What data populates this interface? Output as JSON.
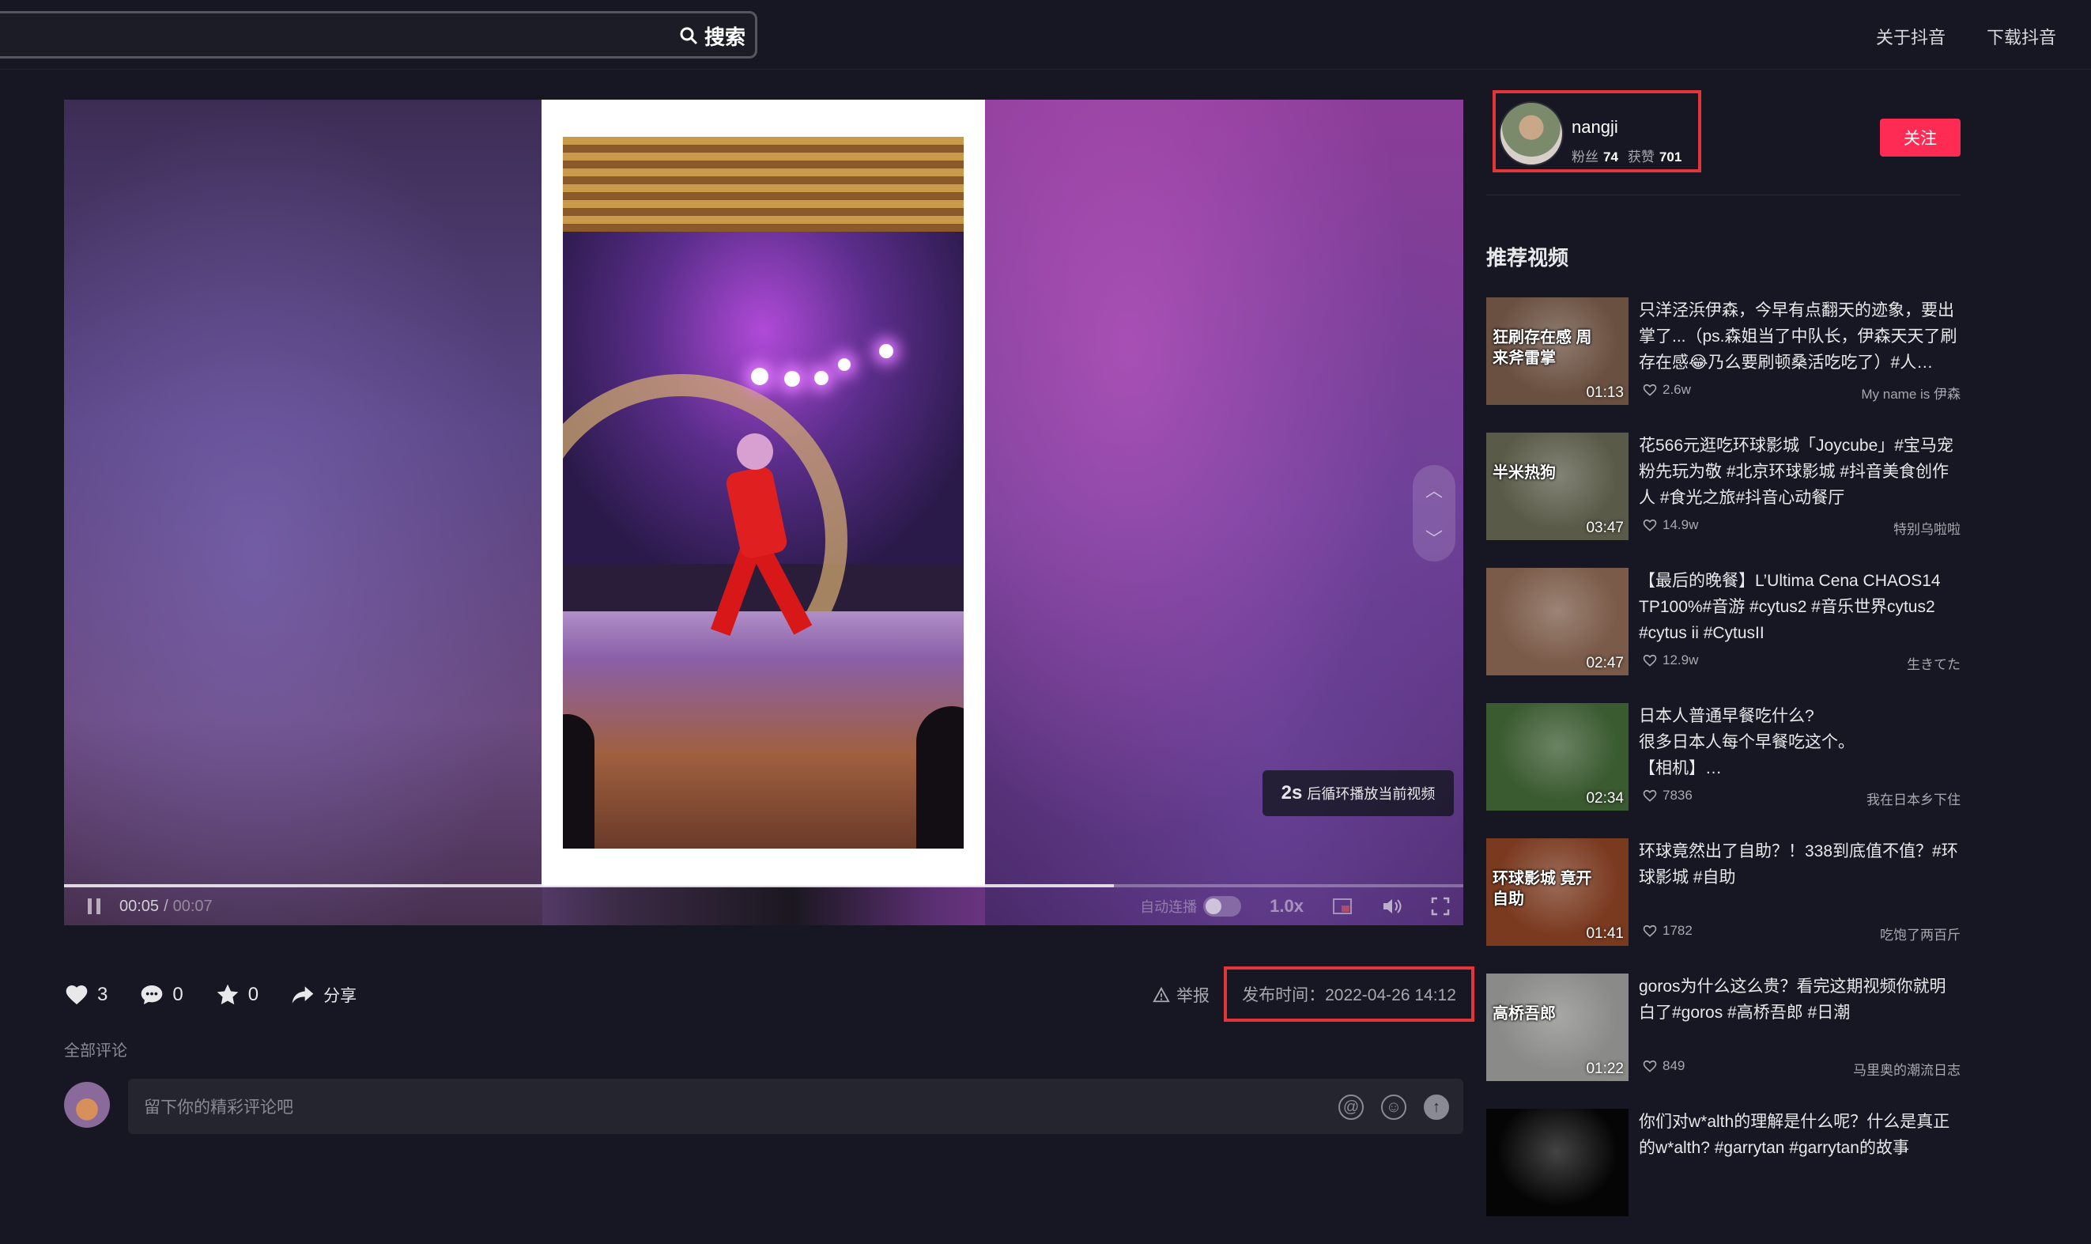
{
  "header": {
    "search_label": "搜索",
    "links": [
      "关于抖音",
      "下载抖音"
    ]
  },
  "player": {
    "loop_hint_seconds": "2s",
    "loop_hint_text": "后循环播放当前视频",
    "current_time": "00:05",
    "separator": "/",
    "total_time": "00:07",
    "progress": 0.75,
    "autoplay_label": "自动连播",
    "speed": "1.0x"
  },
  "actions": {
    "likes": "3",
    "comments": "0",
    "favorites": "0",
    "share_label": "分享",
    "report_label": "举报",
    "publish_time": "发布时间：2022-04-26 14:12"
  },
  "comments": {
    "title": "全部评论",
    "placeholder": "留下你的精彩评论吧"
  },
  "author": {
    "name": "nangji",
    "fans_label": "粉丝",
    "fans": "74",
    "likes_label": "获赞",
    "likes": "701",
    "follow_label": "关注"
  },
  "recommend": {
    "title": "推荐视频",
    "items": [
      {
        "thumb_text": "狂刷存在感 周来斧雷掌",
        "duration": "01:13",
        "desc": "只洋泾浜伊森，今早有点翻天的迹象，要出掌了...（ps.森姐当了中队长，伊森天天了刷存在感😂乃么要刷顿桑活吃吃了）#人…",
        "likes": "2.6w",
        "author": "My name is 伊森",
        "color": "#6a5040"
      },
      {
        "thumb_text": "半米热狗",
        "duration": "03:47",
        "desc": "花566元逛吃环球影城「Joycube」#宝马宠粉先玩为敬 #北京环球影城 #抖音美食创作人 #食光之旅#抖音心动餐厅",
        "likes": "14.9w",
        "author": "特别乌啦啦",
        "color": "#5a5a48"
      },
      {
        "thumb_text": "",
        "duration": "02:47",
        "desc": "【最后的晚餐】L’Ultima Cena CHAOS14 TP100%#音游 #cytus2 #音乐世界cytus2 #cytus ii #CytusII",
        "likes": "12.9w",
        "author": "生きてた",
        "color": "#7a5a48"
      },
      {
        "thumb_text": "",
        "duration": "02:34",
        "desc": "日本人普通早餐吃什么?\n很多日本人每个早餐吃这个。\n【相机】…",
        "likes": "7836",
        "author": "我在日本乡下住",
        "color": "#3a5a30"
      },
      {
        "thumb_text": "环球影城 竟开自助",
        "duration": "01:41",
        "desc": "环球竟然出了自助？！338到底值不值？#环球影城 #自助",
        "likes": "1782",
        "author": "吃饱了两百斤",
        "color": "#7a3a20"
      },
      {
        "thumb_text": "高桥吾郎",
        "duration": "01:22",
        "desc": "goros为什么这么贵？看完这期视频你就明白了#goros #高桥吾郎 #日潮",
        "likes": "849",
        "author": "马里奥的潮流日志",
        "color": "#8a8a88"
      },
      {
        "thumb_text": "",
        "duration": "",
        "desc": "你们对w*alth的理解是什么呢？什么是真正的w*alth? #garrytan #garrytan的故事",
        "likes": "",
        "author": "",
        "color": "#050505"
      }
    ]
  }
}
